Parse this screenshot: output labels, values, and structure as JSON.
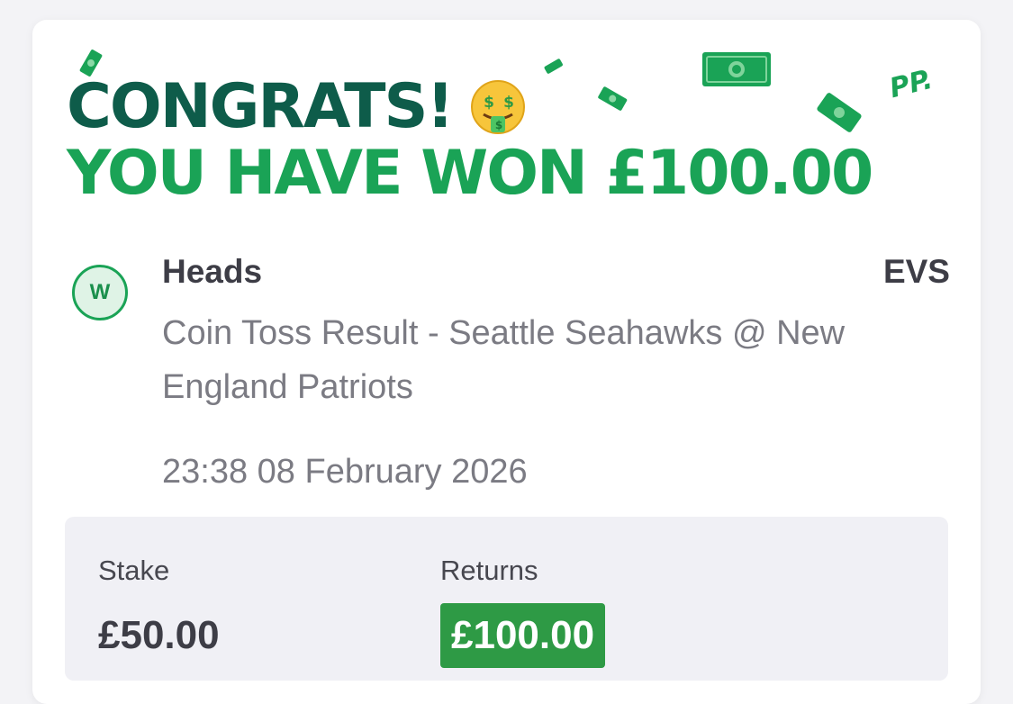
{
  "header": {
    "congrats": "CONGRATS!",
    "won": "YOU HAVE WON £100.00",
    "emoji": "money-mouth-face-icon",
    "brand": "PP."
  },
  "bet": {
    "result_letter": "W",
    "selection": "Heads",
    "odds": "EVS",
    "market": "Coin Toss Result - Seattle Seahawks @ New England Patriots",
    "datetime": "23:38 08 February 2026"
  },
  "summary": {
    "stake_label": "Stake",
    "stake_value": "£50.00",
    "returns_label": "Returns",
    "returns_value": "£100.00"
  },
  "colors": {
    "dark_green": "#0e5c4a",
    "bright_green": "#1aa356",
    "returns_bg": "#2e9a45",
    "panel_bg": "#f0f0f5"
  }
}
